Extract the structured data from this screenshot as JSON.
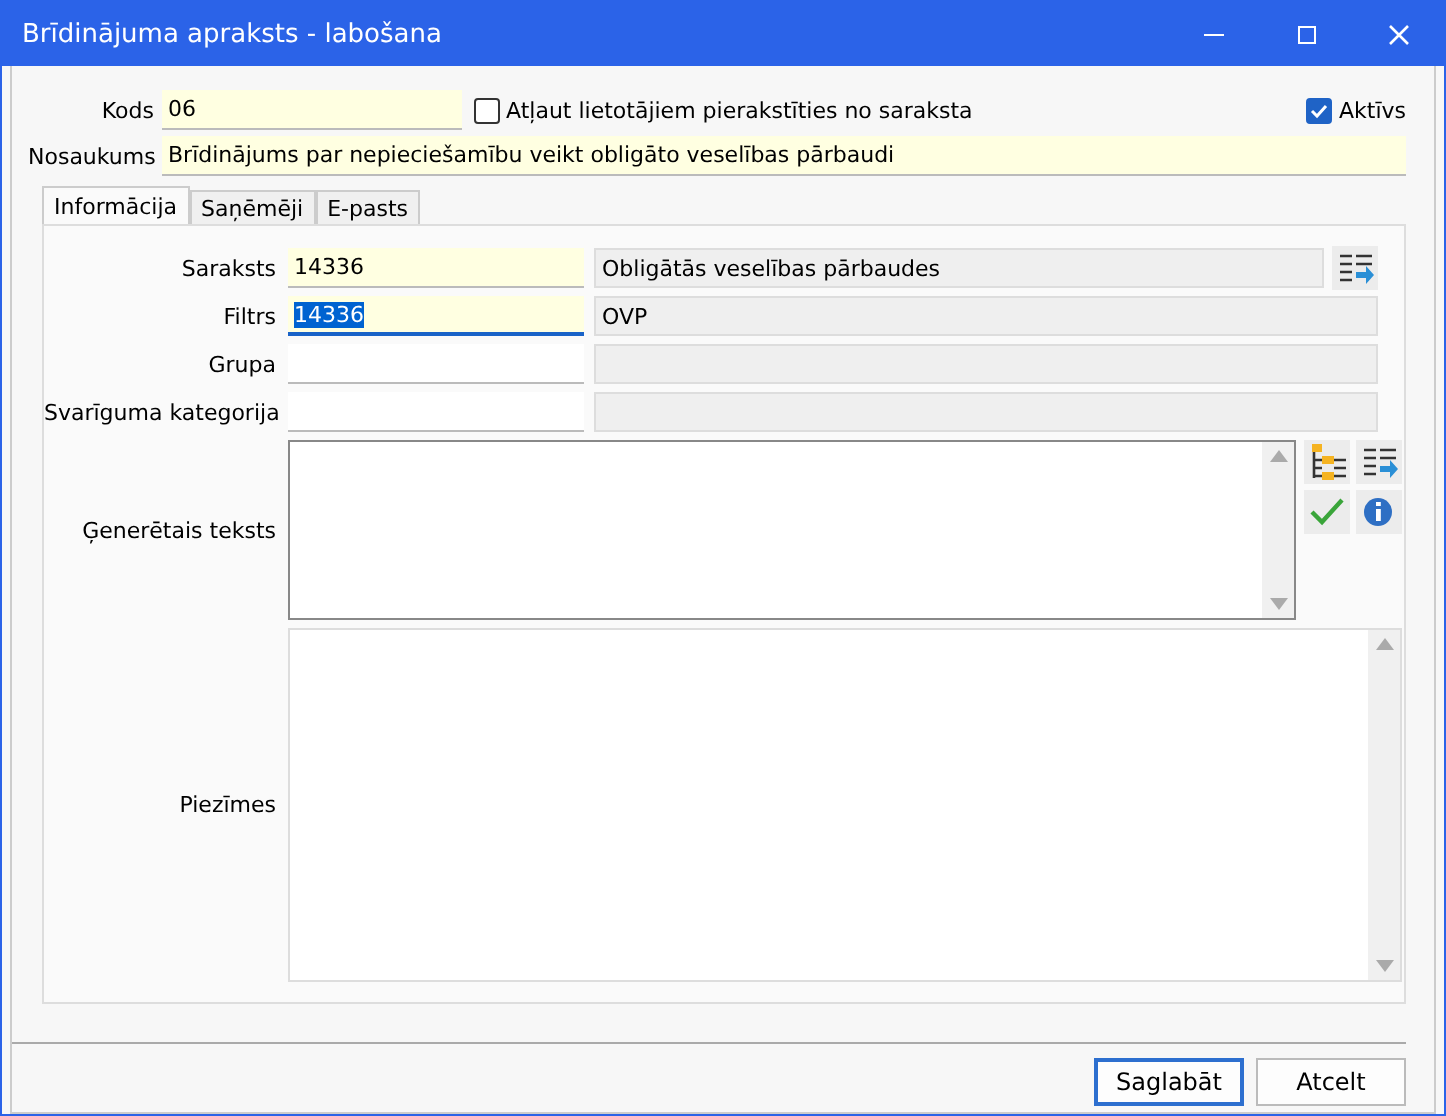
{
  "window": {
    "title": "Brīdinājuma apraksts - labošana"
  },
  "kods": {
    "label": "Kods",
    "value": "06"
  },
  "allow_signup": {
    "label": "Atļaut lietotājiem pierakstīties no saraksta",
    "checked": false
  },
  "active": {
    "label": "Aktīvs",
    "checked": true
  },
  "nosaukums": {
    "label": "Nosaukums",
    "value": "Brīdinājums par nepieciešamību veikt obligāto veselības pārbaudi"
  },
  "tabs": [
    {
      "label": "Informācija",
      "selected": true
    },
    {
      "label": "Saņēmēji",
      "selected": false
    },
    {
      "label": "E-pasts",
      "selected": false
    }
  ],
  "fields": [
    {
      "label": "Saraksts",
      "code": "14336",
      "description": "Obligātās veselības pārbaudes",
      "required": true,
      "focused": false,
      "has_button": true
    },
    {
      "label": "Filtrs",
      "code": "14336",
      "description": "OVP",
      "required": true,
      "focused": true,
      "has_button": false
    },
    {
      "label": "Grupa",
      "required": false,
      "focused": false,
      "has_button": false
    },
    {
      "label": "Svarīguma kategorija",
      "required": false,
      "focused": false,
      "has_button": false
    }
  ],
  "generated_text": {
    "label": "Ģenerētais teksts"
  },
  "notes": {
    "label": "Piezīmes"
  },
  "buttons": [
    {
      "label": "Saglabāt",
      "default": true
    },
    {
      "label": "Atcelt",
      "default": false
    }
  ]
}
